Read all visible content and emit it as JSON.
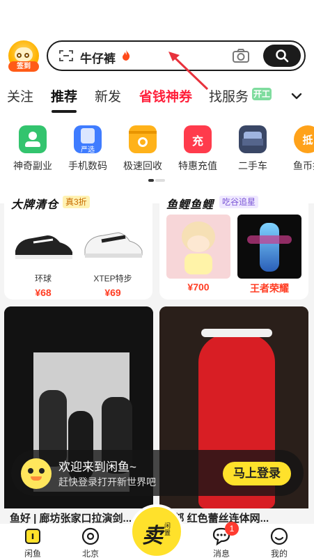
{
  "header": {
    "signin_label": "签到",
    "search_text": "牛仔裤",
    "search_icon": "search-icon",
    "camera_icon": "camera-icon",
    "scan_icon": "scan-icon"
  },
  "tabs": [
    {
      "label": "关注"
    },
    {
      "label": "推荐"
    },
    {
      "label": "新发"
    },
    {
      "label": "省钱神券"
    },
    {
      "label": "找服务"
    }
  ],
  "tab_badge": "开工",
  "categories": [
    {
      "label": "神奇副业",
      "icon": "badge-icon",
      "color": "#33c46e"
    },
    {
      "label": "手机数码",
      "icon": "phone-icon",
      "color": "#3f7cff",
      "tag": "严选"
    },
    {
      "label": "极速回收",
      "icon": "recycle-box-icon",
      "color": "#ffb21a"
    },
    {
      "label": "特惠充值",
      "icon": "recharge-icon",
      "color": "#ff3b4c",
      "glyph": "充"
    },
    {
      "label": "二手车",
      "icon": "car-icon",
      "color": "#3a4766"
    },
    {
      "label": "鱼币抵",
      "icon": "coin-icon",
      "color": "#ffa21a",
      "glyph": "抵"
    }
  ],
  "promo_left": {
    "title": "大牌清仓",
    "tag": "真3折",
    "items": [
      {
        "name": "环球",
        "price": "¥68"
      },
      {
        "name": "XTEP特步",
        "price": "¥69"
      }
    ]
  },
  "promo_right": {
    "title": "鱼鲤鱼鲤",
    "tag": "吃谷追星",
    "items": [
      {
        "name": "",
        "price": "¥700"
      },
      {
        "name": "",
        "price": "王者荣耀"
      }
    ]
  },
  "feed": [
    {
      "title": "鱼好 | 廊坊张家口拉演剑..."
    },
    {
      "title": "...部 红色蕾丝连体网..."
    }
  ],
  "welcome": {
    "line1": "欢迎来到闲鱼~",
    "line2": "赶快登录打开新世界吧",
    "button": "马上登录"
  },
  "bottom_nav": [
    {
      "label": "闲鱼",
      "icon": "home-icon"
    },
    {
      "label": "北京",
      "icon": "location-icon"
    },
    {
      "label": "消息",
      "icon": "message-icon",
      "badge": "1"
    },
    {
      "label": "我的",
      "icon": "profile-icon"
    }
  ],
  "sell": {
    "big": "卖",
    "small": "闲置"
  },
  "colors": {
    "accent": "#ffe12b",
    "promo_red": "#ff1f3a",
    "price": "#ff3c22"
  }
}
